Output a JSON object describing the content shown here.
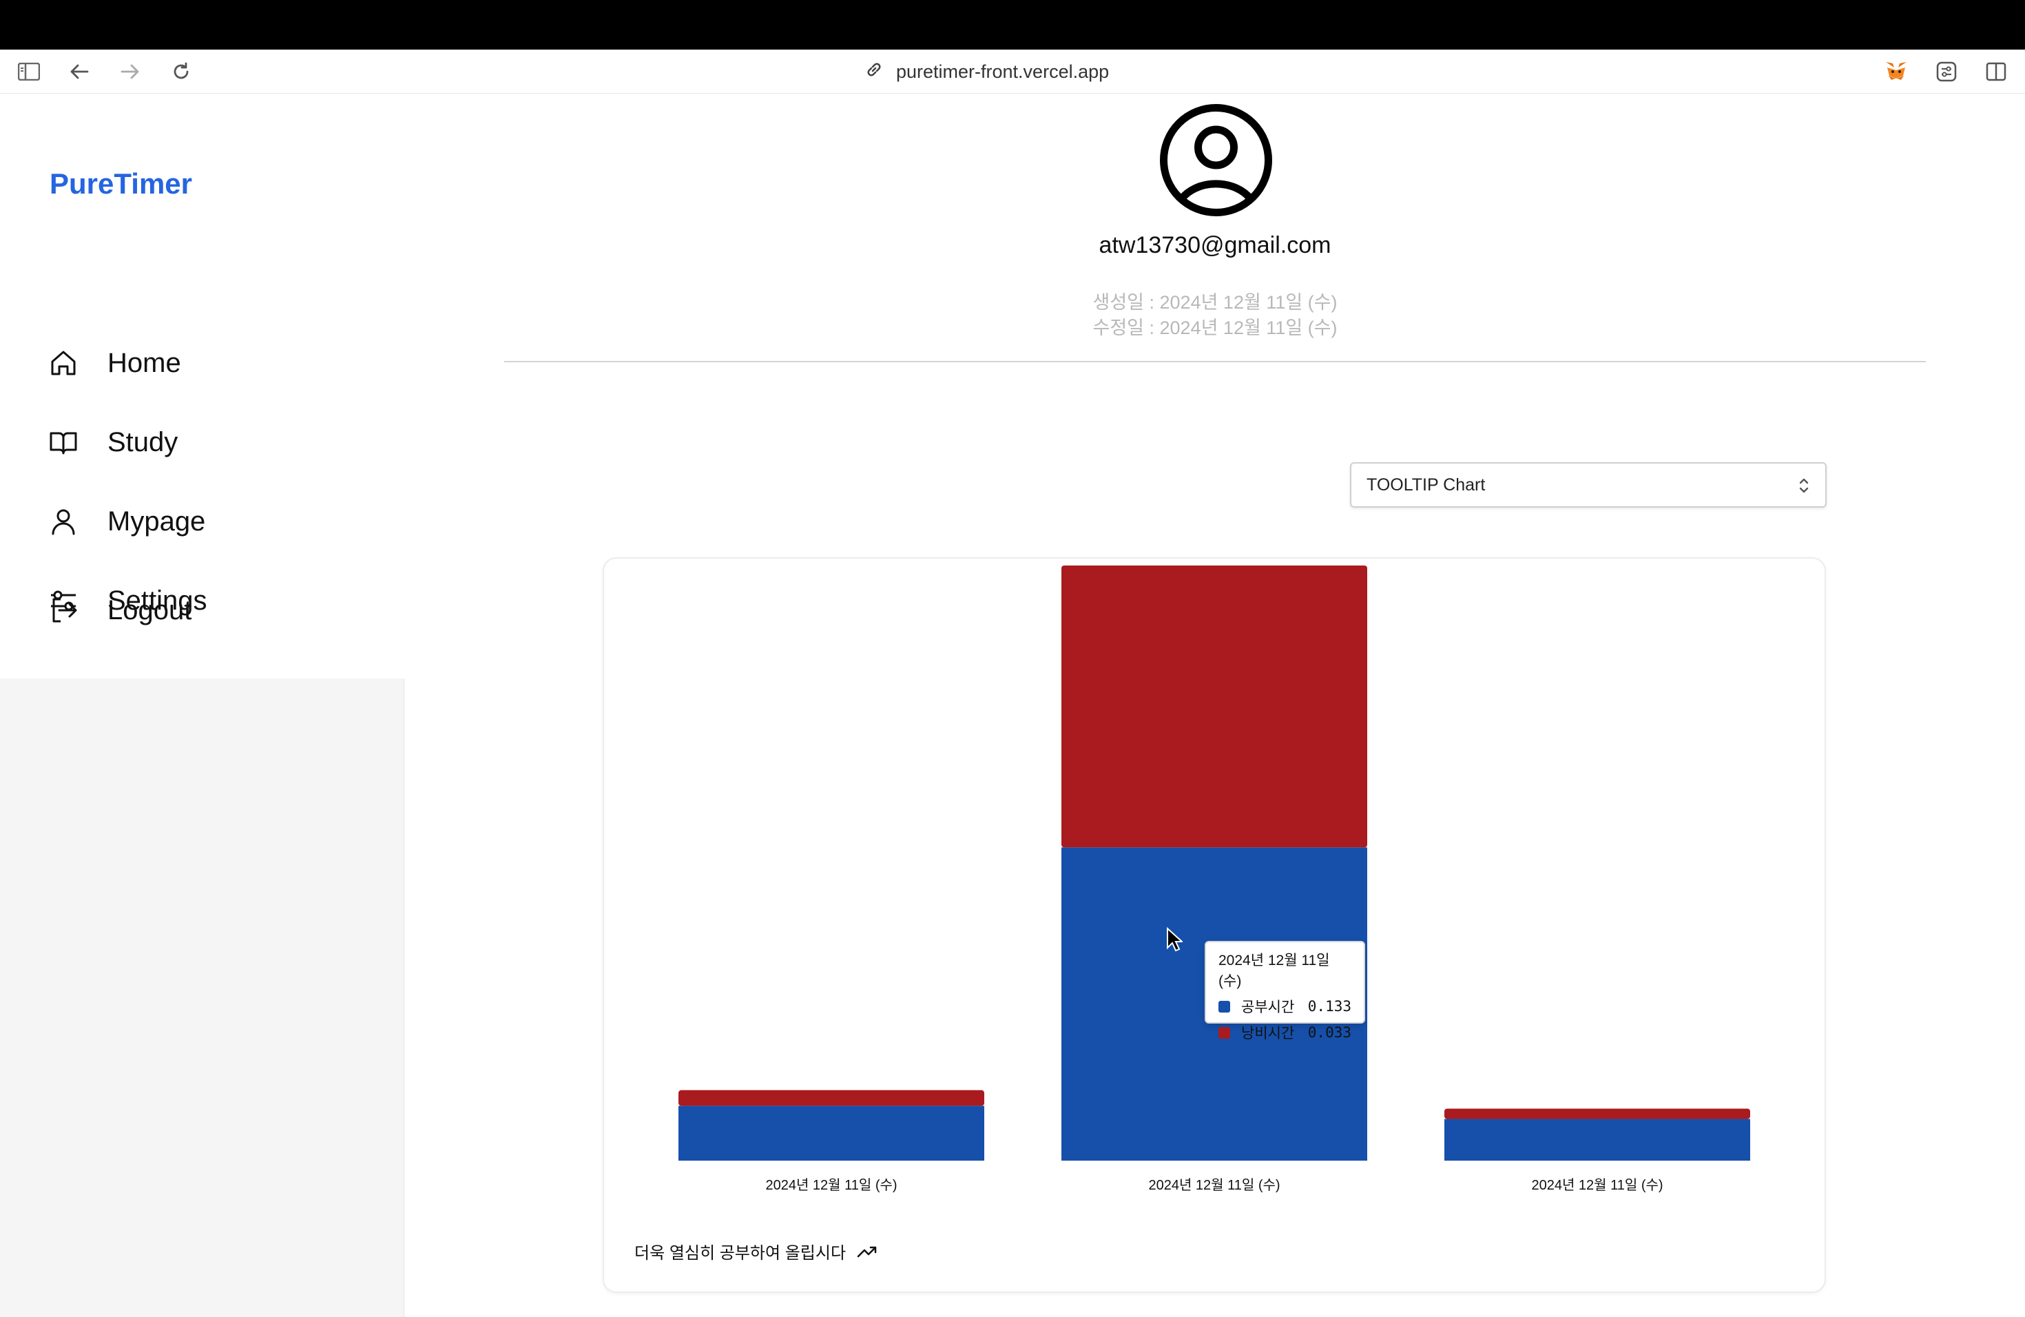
{
  "browser": {
    "url": "puretimer-front.vercel.app"
  },
  "sidebar": {
    "brand": "PureTimer",
    "items": [
      {
        "label": "Home",
        "icon": "home-icon"
      },
      {
        "label": "Study",
        "icon": "book-icon"
      },
      {
        "label": "Mypage",
        "icon": "user-icon"
      },
      {
        "label": "Settings",
        "icon": "sliders-icon"
      },
      {
        "label": "Logout",
        "icon": "logout-icon"
      }
    ]
  },
  "profile": {
    "email": "atw13730@gmail.com",
    "created": "생성일 : 2024년 12월 11일 (수)",
    "modified": "수정일 : 2024년 12월 11일 (수)"
  },
  "chart_select": {
    "value": "TOOLTIP Chart"
  },
  "colors": {
    "brand": "#2565e0",
    "study": "#1650aa",
    "waste": "#a91b1e"
  },
  "chart_data": {
    "type": "bar",
    "stacked": true,
    "categories": [
      "2024년 12월 11일 (수)",
      "2024년 12월 11일 (수)",
      "2024년 12월 11일 (수)"
    ],
    "series": [
      {
        "name": "공부시간",
        "values": [
          0.175,
          1.0,
          0.133
        ],
        "color": "#1650aa"
      },
      {
        "name": "낭비시간",
        "values": [
          0.05,
          0.9,
          0.033
        ],
        "color": "#a91b1e"
      }
    ],
    "ylim": [
      0,
      1.9
    ],
    "grid": false,
    "footer": "더욱 열심히 공부하여 올립시다"
  },
  "tooltip": {
    "title": "2024년 12월 11일 (수)",
    "rows": [
      {
        "label": "공부시간",
        "value": "0.133"
      },
      {
        "label": "낭비시간",
        "value": "0.033"
      }
    ]
  }
}
